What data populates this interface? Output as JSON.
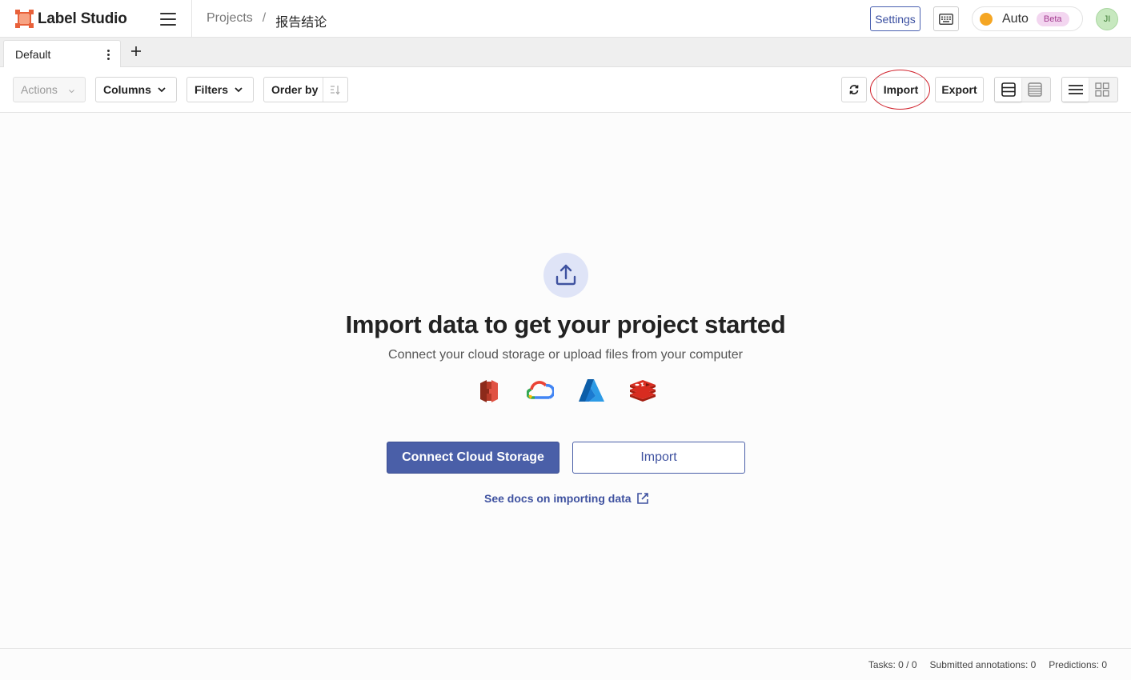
{
  "app": {
    "name": "Label Studio",
    "breadcrumb": {
      "root": "Projects",
      "separator": "/",
      "current": "报告结论"
    }
  },
  "header": {
    "settings_label": "Settings",
    "theme_label": "Auto",
    "beta_label": "Beta",
    "avatar_initials": "JI",
    "icons": [
      "hamburger-icon",
      "keyboard-icon",
      "theme-dot-icon"
    ]
  },
  "tabs": [
    {
      "label": "Default",
      "active": true
    }
  ],
  "toolbar": {
    "actions_label": "Actions",
    "columns_label": "Columns",
    "filters_label": "Filters",
    "order_label": "Order by",
    "import_label": "Import",
    "export_label": "Export"
  },
  "empty_state": {
    "title": "Import data to get your project started",
    "subtitle": "Connect your cloud storage or upload files from your computer",
    "connect_label": "Connect Cloud Storage",
    "import_label": "Import",
    "docs_label": "See docs on importing data",
    "providers": [
      "aws-s3-icon",
      "google-cloud-icon",
      "azure-icon",
      "redis-icon"
    ]
  },
  "footer": {
    "tasks": "Tasks: 0 / 0",
    "submitted": "Submitted annotations: 0",
    "predictions": "Predictions: 0"
  },
  "colors": {
    "primary": "#4a5fa8",
    "accent_orange": "#e8613a",
    "annotation_circle": "#d0202a",
    "theme_dot": "#f5a623"
  }
}
